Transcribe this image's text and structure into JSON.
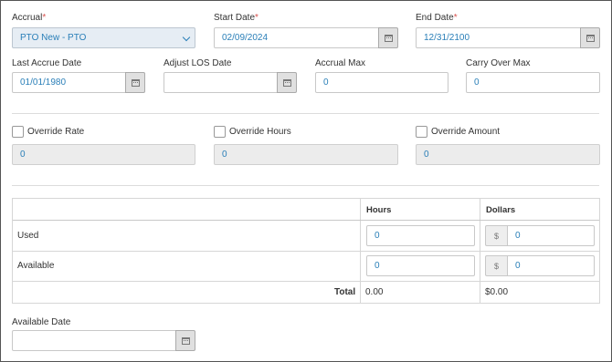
{
  "accrual": {
    "label": "Accrual",
    "value": "PTO New - PTO"
  },
  "start_date": {
    "label": "Start Date",
    "value": "02/09/2024"
  },
  "end_date": {
    "label": "End Date",
    "value": "12/31/2100"
  },
  "last_accrue_date": {
    "label": "Last Accrue Date",
    "value": "01/01/1980"
  },
  "adjust_los_date": {
    "label": "Adjust LOS Date",
    "value": ""
  },
  "accrual_max": {
    "label": "Accrual Max",
    "value": "0"
  },
  "carry_over_max": {
    "label": "Carry Over Max",
    "value": "0"
  },
  "required_marker": "*",
  "override_rate": {
    "label": "Override Rate",
    "value": "0",
    "checked": false
  },
  "override_hours": {
    "label": "Override Hours",
    "value": "0",
    "checked": false
  },
  "override_amount": {
    "label": "Override Amount",
    "value": "0",
    "checked": false
  },
  "table": {
    "col_hours": "Hours",
    "col_dollars": "Dollars",
    "rows": [
      {
        "label": "Used",
        "hours": "0",
        "dollars": "0"
      },
      {
        "label": "Available",
        "hours": "0",
        "dollars": "0"
      }
    ],
    "total_label": "Total",
    "total_hours": "0.00",
    "total_dollars": "$0.00",
    "currency_symbol": "$"
  },
  "available_date": {
    "label": "Available Date",
    "value": ""
  }
}
